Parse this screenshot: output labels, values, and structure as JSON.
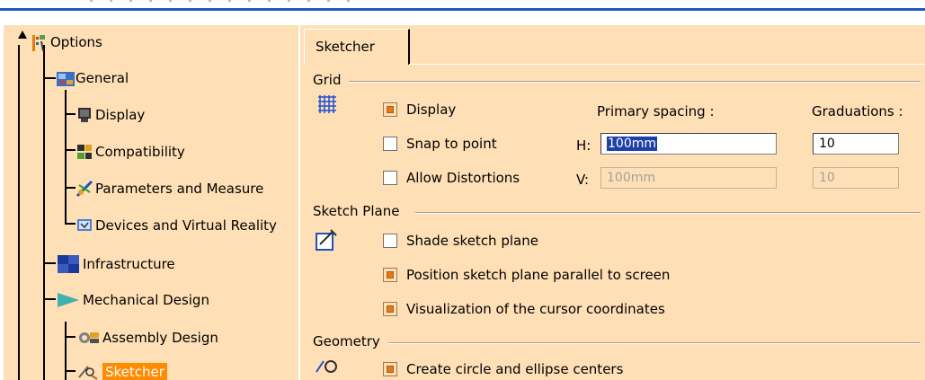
{
  "tree": {
    "items": [
      {
        "label": "Options",
        "icon": "options-icon"
      },
      {
        "label": "General",
        "icon": "general-icon"
      },
      {
        "label": "Display",
        "icon": "display-icon"
      },
      {
        "label": "Compatibility",
        "icon": "compatibility-icon"
      },
      {
        "label": "Parameters and Measure",
        "icon": "parameters-icon"
      },
      {
        "label": "Devices and Virtual Reality",
        "icon": "devices-icon"
      },
      {
        "label": "Infrastructure",
        "icon": "infrastructure-icon"
      },
      {
        "label": "Mechanical Design",
        "icon": "mechanical-design-icon"
      },
      {
        "label": "Assembly Design",
        "icon": "assembly-icon"
      },
      {
        "label": "Sketcher",
        "icon": "sketcher-icon",
        "selected": true
      }
    ]
  },
  "tab": {
    "label": "Sketcher"
  },
  "grid": {
    "title": "Grid",
    "display_label": "Display",
    "display_checked": true,
    "snap_label": "Snap to point",
    "snap_checked": false,
    "distort_label": "Allow Distortions",
    "distort_checked": false,
    "primary_spacing_label": "Primary spacing :",
    "graduations_label": "Graduations :",
    "h_label": "H:",
    "v_label": "V:",
    "h_spacing": "100mm",
    "v_spacing": "100mm",
    "h_graduations": "10",
    "v_graduations": "10"
  },
  "sketch_plane": {
    "title": "Sketch Plane",
    "shade_label": "Shade sketch plane",
    "shade_checked": false,
    "position_label": "Position sketch plane parallel to screen",
    "position_checked": true,
    "cursor_label": "Visualization of the cursor coordinates",
    "cursor_checked": true
  },
  "geometry": {
    "title": "Geometry",
    "centers_label": "Create circle and ellipse centers",
    "centers_checked": true
  },
  "colors": {
    "panel_bg": "#ffe0b6",
    "accent": "#1f57c8",
    "selection": "#ff8c00"
  }
}
